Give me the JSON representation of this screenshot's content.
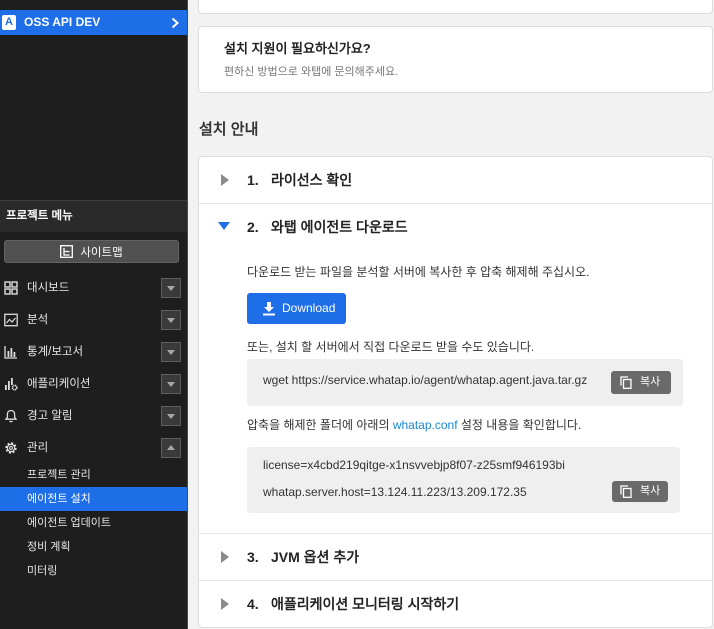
{
  "colors": {
    "accent": "#1e6ee8",
    "link": "#1a8ad4",
    "sidebar_bg": "#1e1e1e",
    "page_bg": "#f2f2f2"
  },
  "sidebar": {
    "project": {
      "badge": "A",
      "name": "OSS API DEV",
      "icon": "chevron-right-icon"
    },
    "menu_header": "프로젝트 메뉴",
    "sitemap": {
      "label": "사이트맵",
      "icon": "sitemap-icon"
    },
    "items": [
      {
        "label": "대시보드",
        "icon": "dashboard-icon",
        "expanded": false
      },
      {
        "label": "분석",
        "icon": "analysis-icon",
        "expanded": false
      },
      {
        "label": "통계/보고서",
        "icon": "bar-chart-icon",
        "expanded": false
      },
      {
        "label": "애플리케이션",
        "icon": "application-icon",
        "expanded": false
      },
      {
        "label": "경고 알림",
        "icon": "bell-icon",
        "expanded": false
      },
      {
        "label": "관리",
        "icon": "gear-icon",
        "expanded": true
      }
    ],
    "management_subitems": [
      {
        "label": "프로젝트 관리",
        "active": false
      },
      {
        "label": "에이전트 설치",
        "active": true
      },
      {
        "label": "에이전트 업데이트",
        "active": false
      },
      {
        "label": "정비 계획",
        "active": false
      },
      {
        "label": "미터링",
        "active": false
      }
    ]
  },
  "support": {
    "title": "설치 지원이 필요하신가요?",
    "subtitle": "편하신 방법으로 와탭에 문의해주세요."
  },
  "guide": {
    "heading": "설치 안내",
    "steps": [
      {
        "number": "1.",
        "title": "라이선스 확인",
        "expanded": false
      },
      {
        "number": "2.",
        "title": "와탭 에이전트 다운로드",
        "expanded": true
      },
      {
        "number": "3.",
        "title": "JVM 옵션 추가",
        "expanded": false
      },
      {
        "number": "4.",
        "title": "애플리케이션 모니터링 시작하기",
        "expanded": false
      }
    ],
    "download_step": {
      "intro": "다운로드 받는 파일을 분석할 서버에 복사한 후 압축 해제해 주십시오.",
      "download_label": "Download",
      "download_icon": "download-icon",
      "alt_text": "또는, 설치 할 서버에서 직접 다운로드 받을 수도 있습니다.",
      "wget_command": "wget https://service.whatap.io/agent/whatap.agent.java.tar.gz",
      "copy_label": "복사",
      "copy_icon": "copy-icon",
      "conf_text_before": "압축을 해제한 폴더에 아래의 ",
      "conf_link": "whatap.conf",
      "conf_text_after": " 설정 내용을 확인합니다.",
      "conf_lines": [
        "license=x4cbd219qitge-x1nsvvebjp8f07-z25smf946193bi",
        "whatap.server.host=13.124.11.223/13.209.172.35"
      ]
    }
  }
}
